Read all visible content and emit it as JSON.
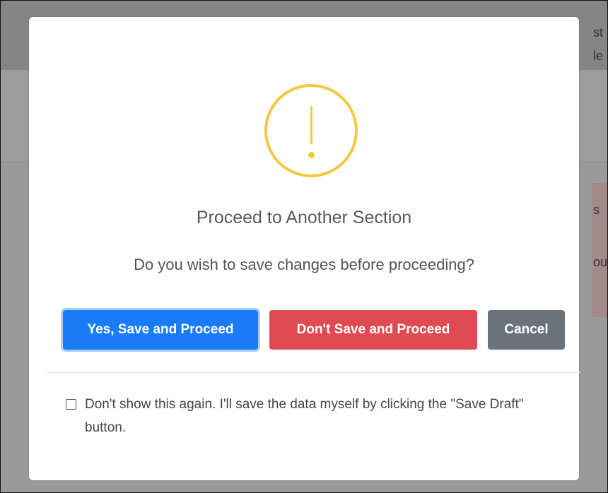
{
  "background": {
    "fragments": [
      "st",
      "le",
      "s",
      "ou"
    ]
  },
  "modal": {
    "icon": "warning-exclamation-icon",
    "icon_color": "#f5c842",
    "title": "Proceed to Another Section",
    "message": "Do you wish to save changes before proceeding?",
    "buttons": {
      "save_proceed": "Yes, Save and Proceed",
      "dont_save_proceed": "Don't Save and Proceed",
      "cancel": "Cancel"
    },
    "colors": {
      "primary": "#1a7bf7",
      "danger": "#e04a52",
      "secondary": "#6a737b"
    },
    "dont_show_again": {
      "checked": false,
      "label": "Don't show this again. I'll save the data myself by clicking the \"Save Draft\" button."
    }
  }
}
